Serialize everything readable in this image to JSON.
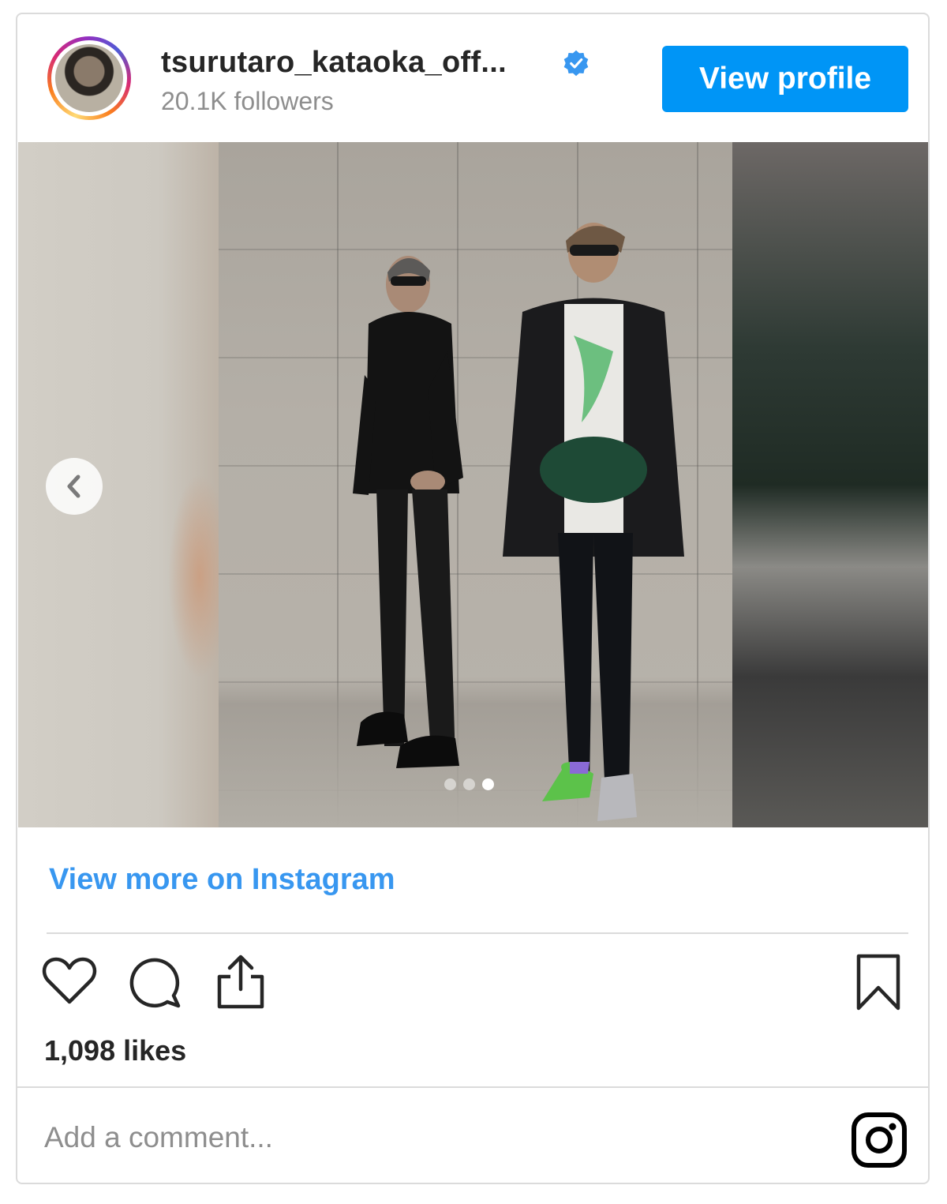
{
  "header": {
    "username": "tsurutaro_kataoka_off...",
    "followers": "20.1K followers",
    "view_profile_label": "View profile"
  },
  "carousel": {
    "total_slides": 3,
    "active_slide": 3
  },
  "links": {
    "view_more": "View more on Instagram"
  },
  "stats": {
    "likes": "1,098 likes"
  },
  "comment": {
    "placeholder": "Add a comment..."
  },
  "colors": {
    "accent": "#0095f6",
    "link": "#3897f0",
    "text": "#262626",
    "muted": "#8e8e8e",
    "border": "#dbdbdb"
  },
  "icons": {
    "verified": "verified-badge-icon",
    "prev": "chevron-left-icon",
    "like": "heart-icon",
    "comment": "comment-bubble-icon",
    "share": "share-icon",
    "save": "bookmark-icon",
    "brand": "instagram-logo-icon"
  }
}
